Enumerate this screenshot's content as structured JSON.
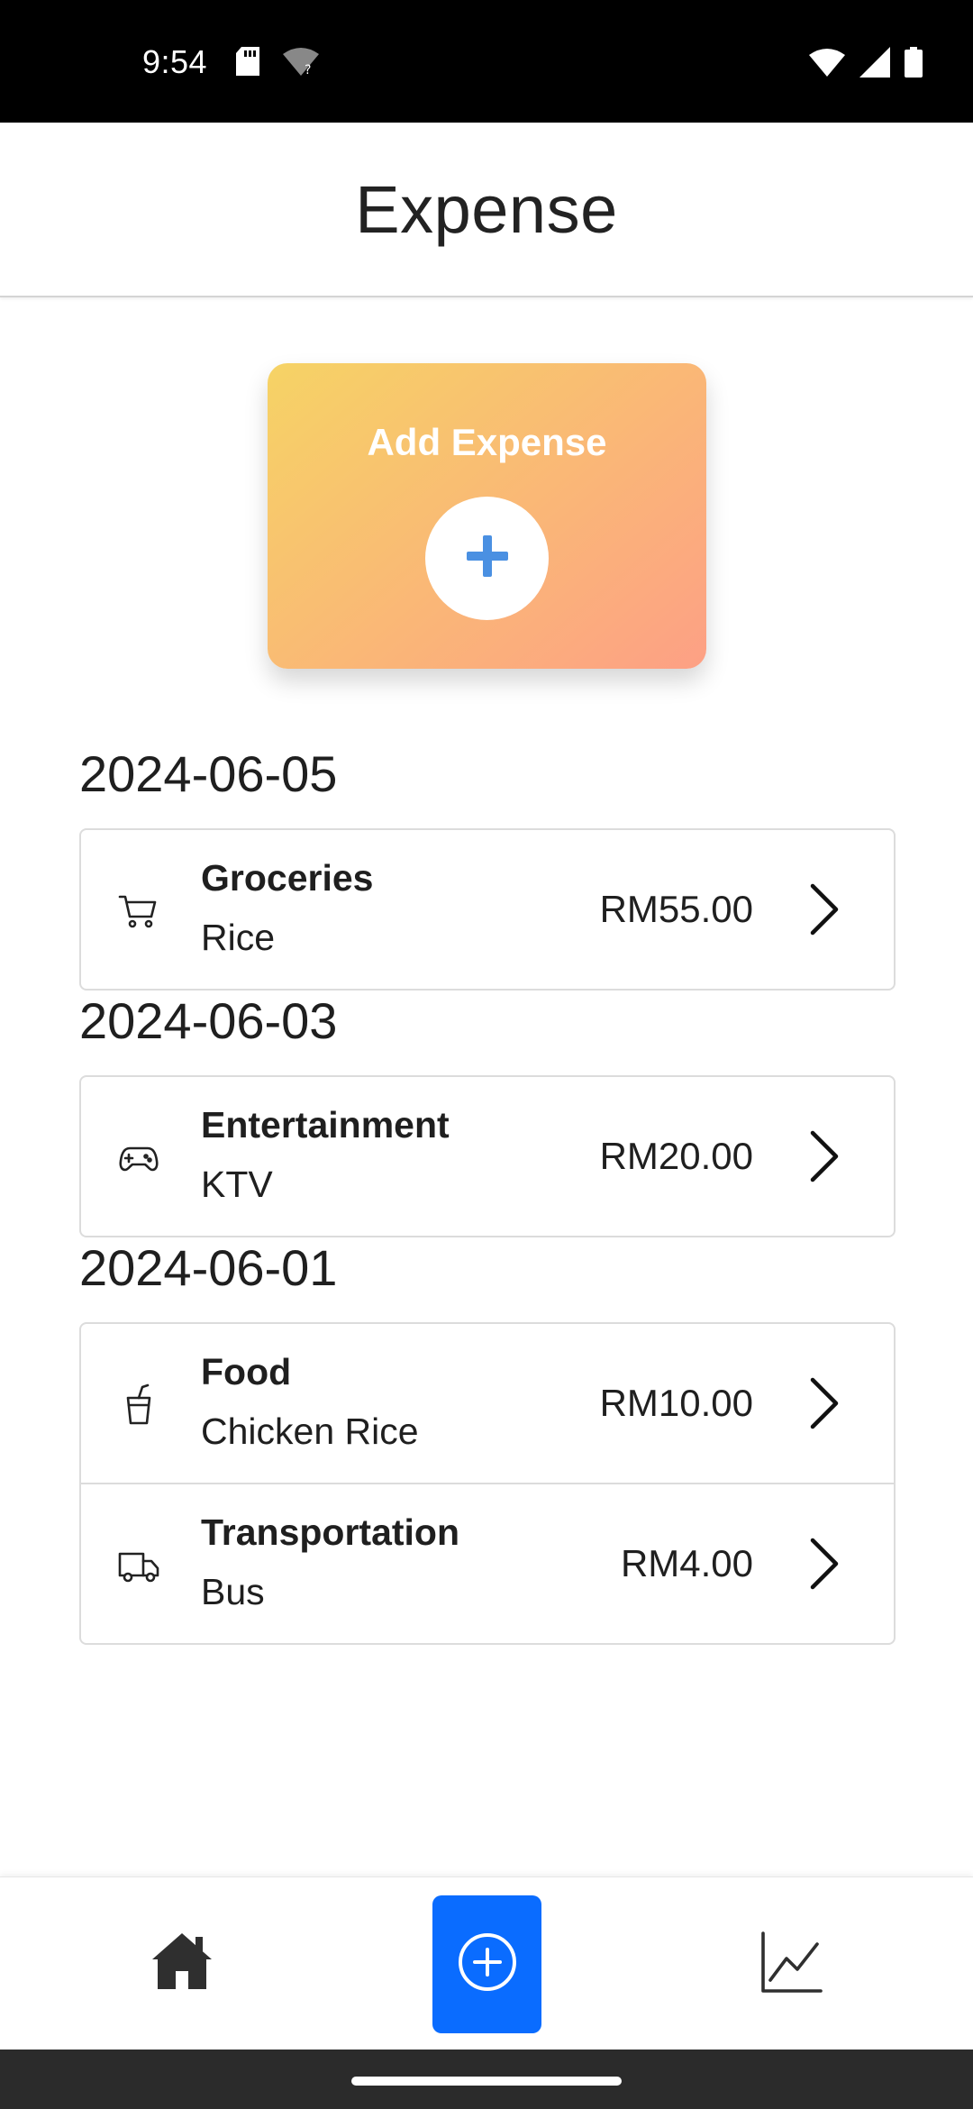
{
  "status_bar": {
    "time": "9:54",
    "left_icons": [
      "sd-card-icon",
      "wifi-unknown-icon"
    ],
    "right_icons": [
      "wifi-icon",
      "signal-icon",
      "battery-icon"
    ]
  },
  "header": {
    "title": "Expense"
  },
  "add_card": {
    "label": "Add Expense",
    "icon": "plus-icon",
    "gradient": [
      "#f6d365",
      "#fda085"
    ],
    "plus_color": "#4a90e2"
  },
  "groups": [
    {
      "date": "2024-06-05",
      "items": [
        {
          "icon": "cart-icon",
          "category": "Groceries",
          "note": "Rice",
          "amount": "RM55.00"
        }
      ]
    },
    {
      "date": "2024-06-03",
      "items": [
        {
          "icon": "gamepad-icon",
          "category": "Entertainment",
          "note": "KTV",
          "amount": "RM20.00"
        }
      ]
    },
    {
      "date": "2024-06-01",
      "items": [
        {
          "icon": "cup-icon",
          "category": "Food",
          "note": "Chicken Rice",
          "amount": "RM10.00"
        },
        {
          "icon": "truck-icon",
          "category": "Transportation",
          "note": "Bus",
          "amount": "RM4.00"
        }
      ]
    }
  ],
  "bottom_nav": {
    "items": [
      {
        "icon": "home-icon",
        "active": false
      },
      {
        "icon": "add-circle-icon",
        "active": true
      },
      {
        "icon": "chart-line-icon",
        "active": false
      }
    ],
    "active_color": "#0a6cff"
  }
}
